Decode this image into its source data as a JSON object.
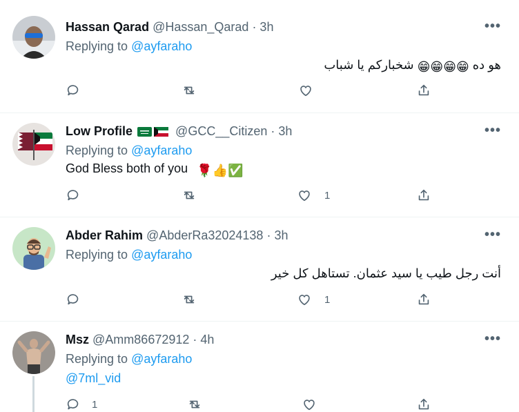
{
  "tweets": [
    {
      "name": "Hassan Qarad",
      "handle": "@Hassan_Qarad",
      "time": "· 3h",
      "replying_prefix": "Replying to ",
      "replying_to": "@ayfaraho",
      "text_before": "هو ده",
      "emoji": "😁😁😁😁",
      "text_after": "شخباركم يا شباب",
      "more": "•••",
      "replies": "",
      "retweets": "",
      "likes": ""
    },
    {
      "name": "Low Profile",
      "handle": "@GCC__Citizen",
      "time": "· 3h",
      "replying_prefix": "Replying to ",
      "replying_to": "@ayfaraho",
      "text": "God Bless both of you",
      "emoji": "🌹👍✅",
      "more": "•••",
      "likes": "1"
    },
    {
      "name": "Abder Rahim",
      "handle": "@AbderRa32024138",
      "time": "· 3h",
      "replying_prefix": "Replying to ",
      "replying_to": "@ayfaraho",
      "text": "أنت رجل طيب يا سيد عثمان. تستاهل كل خير",
      "more": "•••",
      "likes": "1"
    },
    {
      "name": "Msz",
      "handle": "@Amm86672912",
      "time": "· 4h",
      "replying_prefix": "Replying to ",
      "replying_to": "@ayfaraho",
      "text": "@7ml_vid",
      "more": "•••",
      "replies": "1"
    }
  ],
  "colors": {
    "accent": "#1d9bf0",
    "secondary": "#536471",
    "divider": "#eff3f4"
  },
  "icons": [
    "reply-icon",
    "retweet-icon",
    "like-icon",
    "share-icon",
    "more-icon"
  ]
}
